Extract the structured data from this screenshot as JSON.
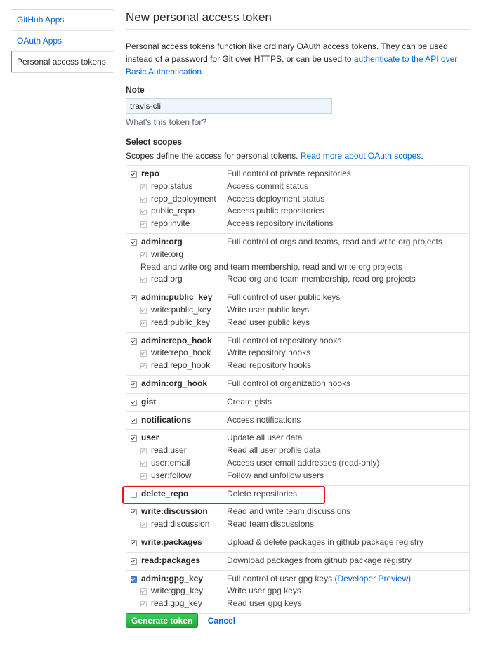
{
  "sidebar": {
    "items": [
      {
        "label": "GitHub Apps"
      },
      {
        "label": "OAuth Apps"
      },
      {
        "label": "Personal access tokens"
      }
    ]
  },
  "page": {
    "title": "New personal access token",
    "intro_text": "Personal access tokens function like ordinary OAuth access tokens. They can be used instead of a password for Git over HTTPS, or can be used to ",
    "intro_link": "authenticate to the API over Basic Authentication",
    "intro_end": "."
  },
  "note": {
    "label": "Note",
    "value": "travis-cli",
    "hint": "What's this token for?"
  },
  "scopes": {
    "label": "Select scopes",
    "desc_text": "Scopes define the access for personal tokens. ",
    "desc_link": "Read more about OAuth scopes",
    "desc_end": ".",
    "groups": [
      {
        "rows": [
          {
            "name": "repo",
            "desc": "Full control of private repositories",
            "checked": true
          },
          {
            "name": "repo:status",
            "desc": "Access commit status",
            "checked": true
          },
          {
            "name": "repo_deployment",
            "desc": "Access deployment status",
            "checked": true
          },
          {
            "name": "public_repo",
            "desc": "Access public repositories",
            "checked": true
          },
          {
            "name": "repo:invite",
            "desc": "Access repository invitations",
            "checked": true
          }
        ]
      },
      {
        "rows": [
          {
            "name": "admin:org",
            "desc": "Full control of orgs and teams, read and write org projects",
            "checked": true
          },
          {
            "name": "write:org",
            "checked": true
          },
          {
            "full": "Read and write org and team membership, read and write org projects"
          },
          {
            "name": "read:org",
            "desc": "Read org and team membership, read org projects",
            "checked": true
          }
        ]
      },
      {
        "rows": [
          {
            "name": "admin:public_key",
            "desc": "Full control of user public keys",
            "checked": true
          },
          {
            "name": "write:public_key",
            "desc": "Write user public keys",
            "checked": true
          },
          {
            "name": "read:public_key",
            "desc": "Read user public keys",
            "checked": true
          }
        ]
      },
      {
        "rows": [
          {
            "name": "admin:repo_hook",
            "desc": "Full control of repository hooks",
            "checked": true
          },
          {
            "name": "write:repo_hook",
            "desc": "Write repository hooks",
            "checked": true
          },
          {
            "name": "read:repo_hook",
            "desc": "Read repository hooks",
            "checked": true
          }
        ]
      },
      {
        "rows": [
          {
            "name": "admin:org_hook",
            "desc": "Full control of organization hooks",
            "checked": true
          }
        ]
      },
      {
        "rows": [
          {
            "name": "gist",
            "desc": "Create gists",
            "checked": true
          }
        ]
      },
      {
        "rows": [
          {
            "name": "notifications",
            "desc": "Access notifications",
            "checked": true
          }
        ]
      },
      {
        "rows": [
          {
            "name": "user",
            "desc": "Update all user data",
            "checked": true
          },
          {
            "name": "read:user",
            "desc": "Read all user profile data",
            "checked": true
          },
          {
            "name": "user:email",
            "desc": "Access user email addresses (read-only)",
            "checked": true
          },
          {
            "name": "user:follow",
            "desc": "Follow and unfollow users",
            "checked": true
          }
        ]
      },
      {
        "highlight": true,
        "rows": [
          {
            "name": "delete_repo",
            "desc": "Delete repositories",
            "checked": false
          }
        ]
      },
      {
        "rows": [
          {
            "name": "write:discussion",
            "desc": "Read and write team discussions",
            "checked": true
          },
          {
            "name": "read:discussion",
            "desc": "Read team discussions",
            "checked": true
          }
        ]
      },
      {
        "rows": [
          {
            "name": "write:packages",
            "desc": "Upload & delete packages in github package registry",
            "checked": true
          }
        ]
      },
      {
        "rows": [
          {
            "name": "read:packages",
            "desc": "Download packages from github package registry",
            "checked": true
          }
        ]
      },
      {
        "rows": [
          {
            "name": "admin:gpg_key",
            "desc": "Full control of user gpg keys ",
            "desc_link": "(Developer Preview)",
            "checked": true,
            "blue": true
          },
          {
            "name": "write:gpg_key",
            "desc": "Write user gpg keys",
            "checked": true
          },
          {
            "name": "read:gpg_key",
            "desc": "Read user gpg keys",
            "checked": true
          }
        ]
      }
    ]
  },
  "actions": {
    "generate_label": "Generate token",
    "cancel_label": "Cancel"
  },
  "colors": {
    "link": "#0366d6",
    "primary_button": "#28a745",
    "selected_indicator": "#e36209",
    "highlight_box": "#e6151a"
  }
}
